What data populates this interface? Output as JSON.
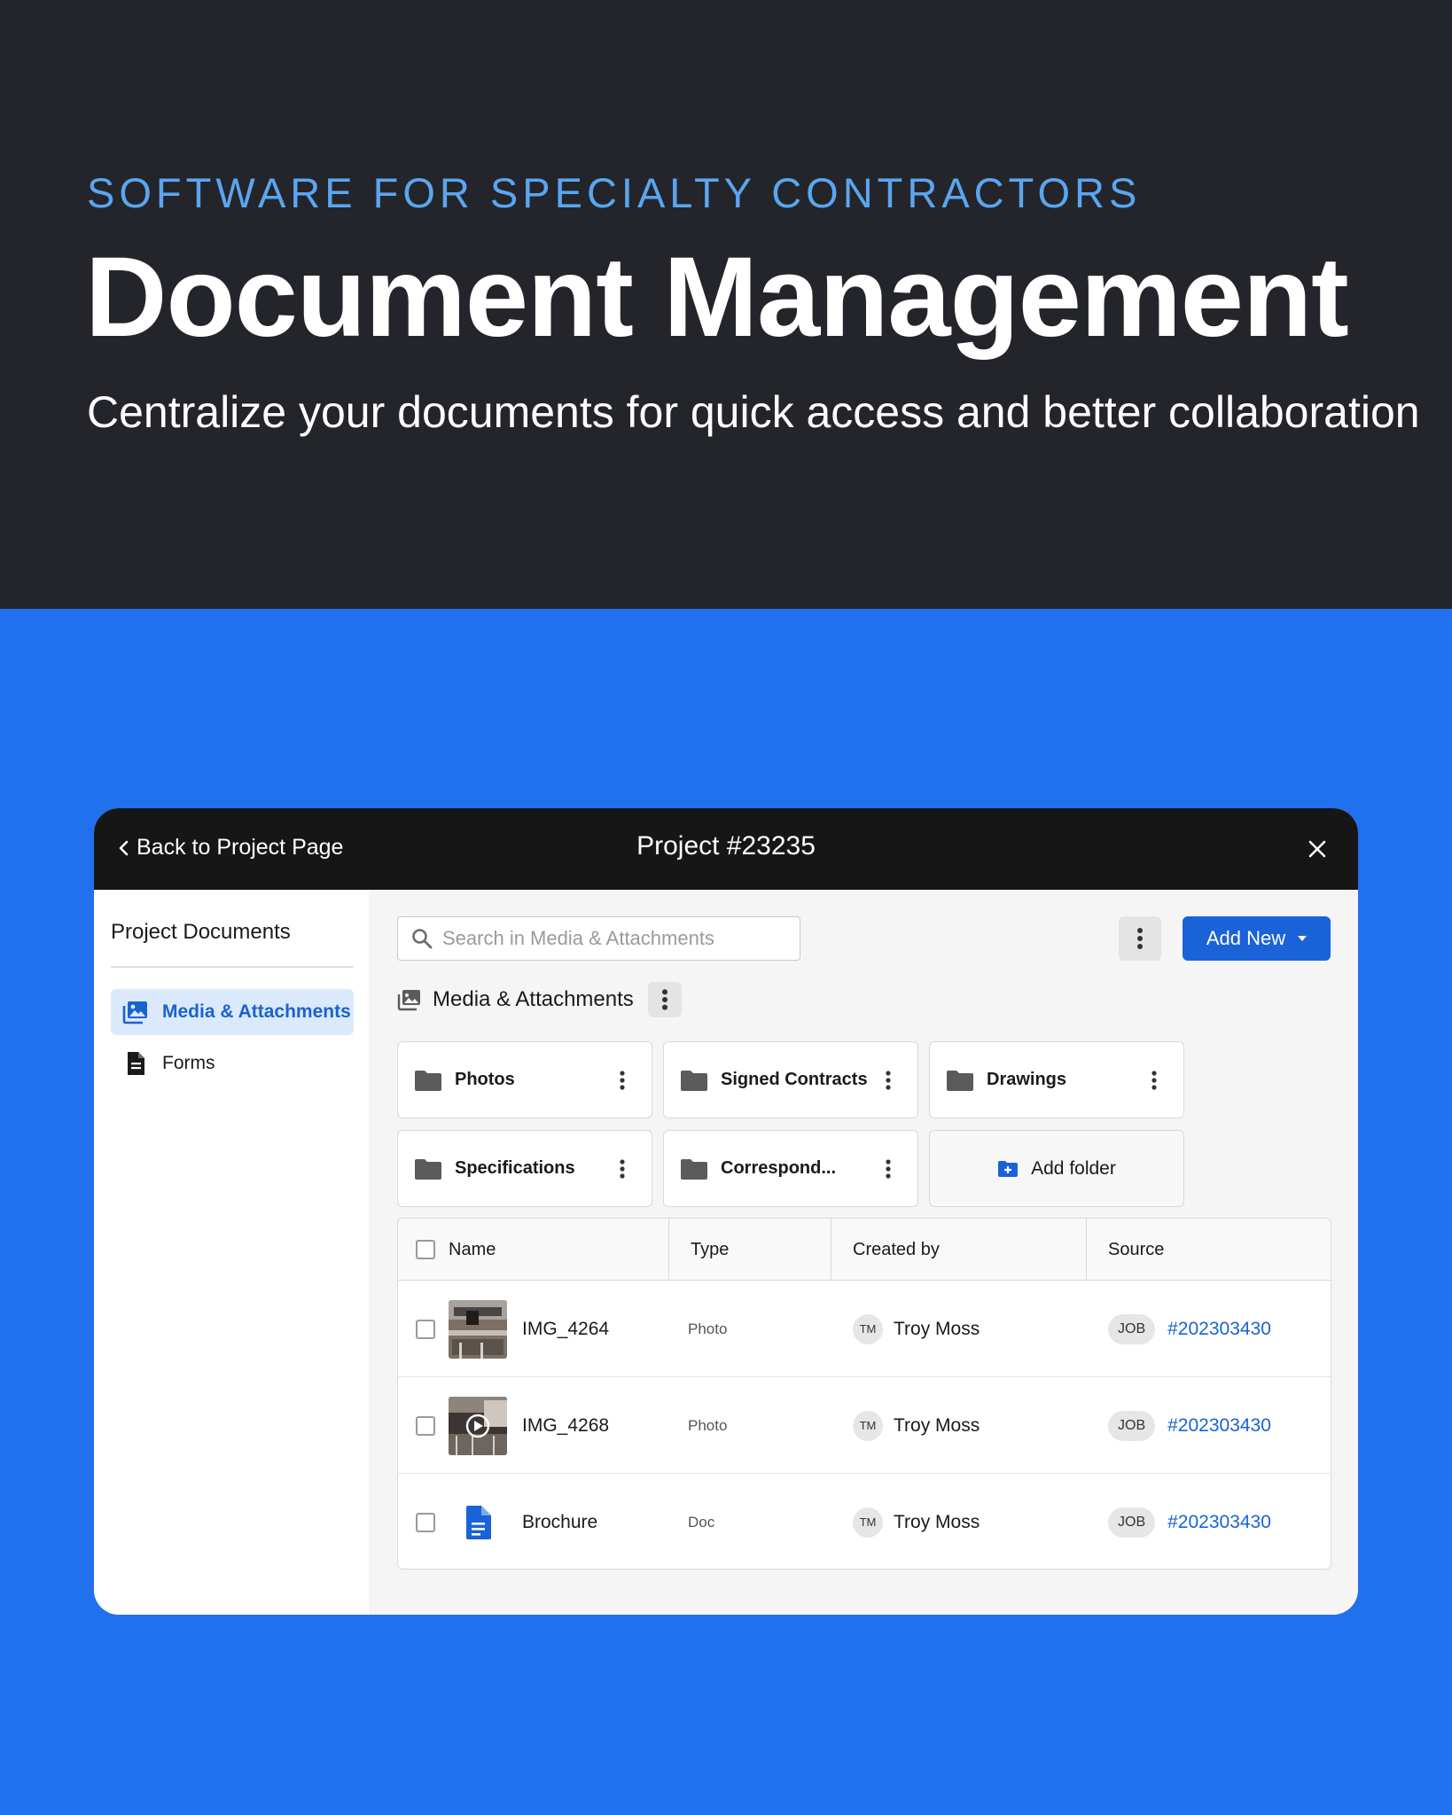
{
  "hero": {
    "eyebrow": "SOFTWARE FOR SPECIALTY CONTRACTORS",
    "headline": "Document Management",
    "subhead": "Centralize your documents for quick access and better collaboration"
  },
  "window": {
    "back_label": "Back to Project Page",
    "title": "Project #23235",
    "close_icon": "close-icon"
  },
  "sidebar": {
    "title": "Project Documents",
    "items": [
      {
        "label": "Media & Attachments",
        "icon": "media-gallery-icon",
        "active": true
      },
      {
        "label": "Forms",
        "icon": "document-icon",
        "active": false
      }
    ]
  },
  "toolbar": {
    "search_placeholder": "Search in Media & Attachments",
    "add_new_label": "Add New"
  },
  "section": {
    "title": "Media & Attachments"
  },
  "folders": [
    {
      "name": "Photos"
    },
    {
      "name": "Signed Contracts"
    },
    {
      "name": "Drawings"
    },
    {
      "name": "Specifications"
    },
    {
      "name": "Correspond..."
    }
  ],
  "add_folder_label": "Add folder",
  "table": {
    "columns": [
      "Name",
      "Type",
      "Created by",
      "Source"
    ],
    "rows": [
      {
        "name": "IMG_4264",
        "type": "Photo",
        "creator_initials": "TM",
        "creator": "Troy Moss",
        "source_badge": "JOB",
        "source_link": "#202303430",
        "thumb": "photo"
      },
      {
        "name": "IMG_4268",
        "type": "Photo",
        "creator_initials": "TM",
        "creator": "Troy Moss",
        "source_badge": "JOB",
        "source_link": "#202303430",
        "thumb": "video"
      },
      {
        "name": "Brochure",
        "type": "Doc",
        "creator_initials": "TM",
        "creator": "Troy Moss",
        "source_badge": "JOB",
        "source_link": "#202303430",
        "thumb": "doc"
      }
    ]
  },
  "colors": {
    "hero_bg": "#23252a",
    "page_blue": "#2170ee",
    "accent_blue": "#1a62d8",
    "eyebrow": "#5ba5f0"
  }
}
